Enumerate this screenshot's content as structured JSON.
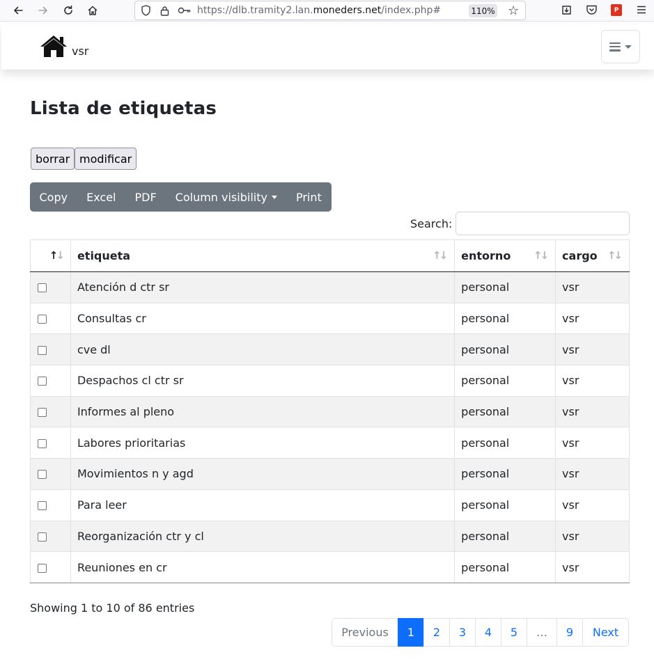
{
  "browser": {
    "url_prefix": "https://dlb.tramity2.lan.",
    "url_domain": "moneders.net",
    "url_suffix": "/index.php#",
    "zoom": "110%"
  },
  "navbar": {
    "brand_text": "vsr",
    "brand_icon": "home-icon",
    "menu_icon": "hamburger-icon"
  },
  "page": {
    "title": "Lista de etiquetas"
  },
  "actions": {
    "delete_label": "borrar",
    "modify_label": "modificar"
  },
  "export_buttons": {
    "copy": "Copy",
    "excel": "Excel",
    "pdf": "PDF",
    "column_visibility": "Column visibility",
    "print": "Print"
  },
  "search": {
    "label": "Search:",
    "value": ""
  },
  "table": {
    "columns": [
      "etiqueta",
      "entorno",
      "cargo"
    ],
    "rows": [
      {
        "etiqueta": "Atención d ctr sr",
        "entorno": "personal",
        "cargo": "vsr"
      },
      {
        "etiqueta": "Consultas cr",
        "entorno": "personal",
        "cargo": "vsr"
      },
      {
        "etiqueta": "cve dl",
        "entorno": "personal",
        "cargo": "vsr"
      },
      {
        "etiqueta": "Despachos cl ctr sr",
        "entorno": "personal",
        "cargo": "vsr"
      },
      {
        "etiqueta": "Informes al pleno",
        "entorno": "personal",
        "cargo": "vsr"
      },
      {
        "etiqueta": "Labores prioritarias",
        "entorno": "personal",
        "cargo": "vsr"
      },
      {
        "etiqueta": "Movimientos n y agd",
        "entorno": "personal",
        "cargo": "vsr"
      },
      {
        "etiqueta": "Para leer",
        "entorno": "personal",
        "cargo": "vsr"
      },
      {
        "etiqueta": "Reorganización ctr y cl",
        "entorno": "personal",
        "cargo": "vsr"
      },
      {
        "etiqueta": "Reuniones en cr",
        "entorno": "personal",
        "cargo": "vsr"
      }
    ]
  },
  "footer": {
    "info": "Showing 1 to 10 of 86 entries",
    "pagination": {
      "previous": "Previous",
      "pages": [
        "1",
        "2",
        "3",
        "4",
        "5",
        "…",
        "9"
      ],
      "next": "Next"
    }
  }
}
